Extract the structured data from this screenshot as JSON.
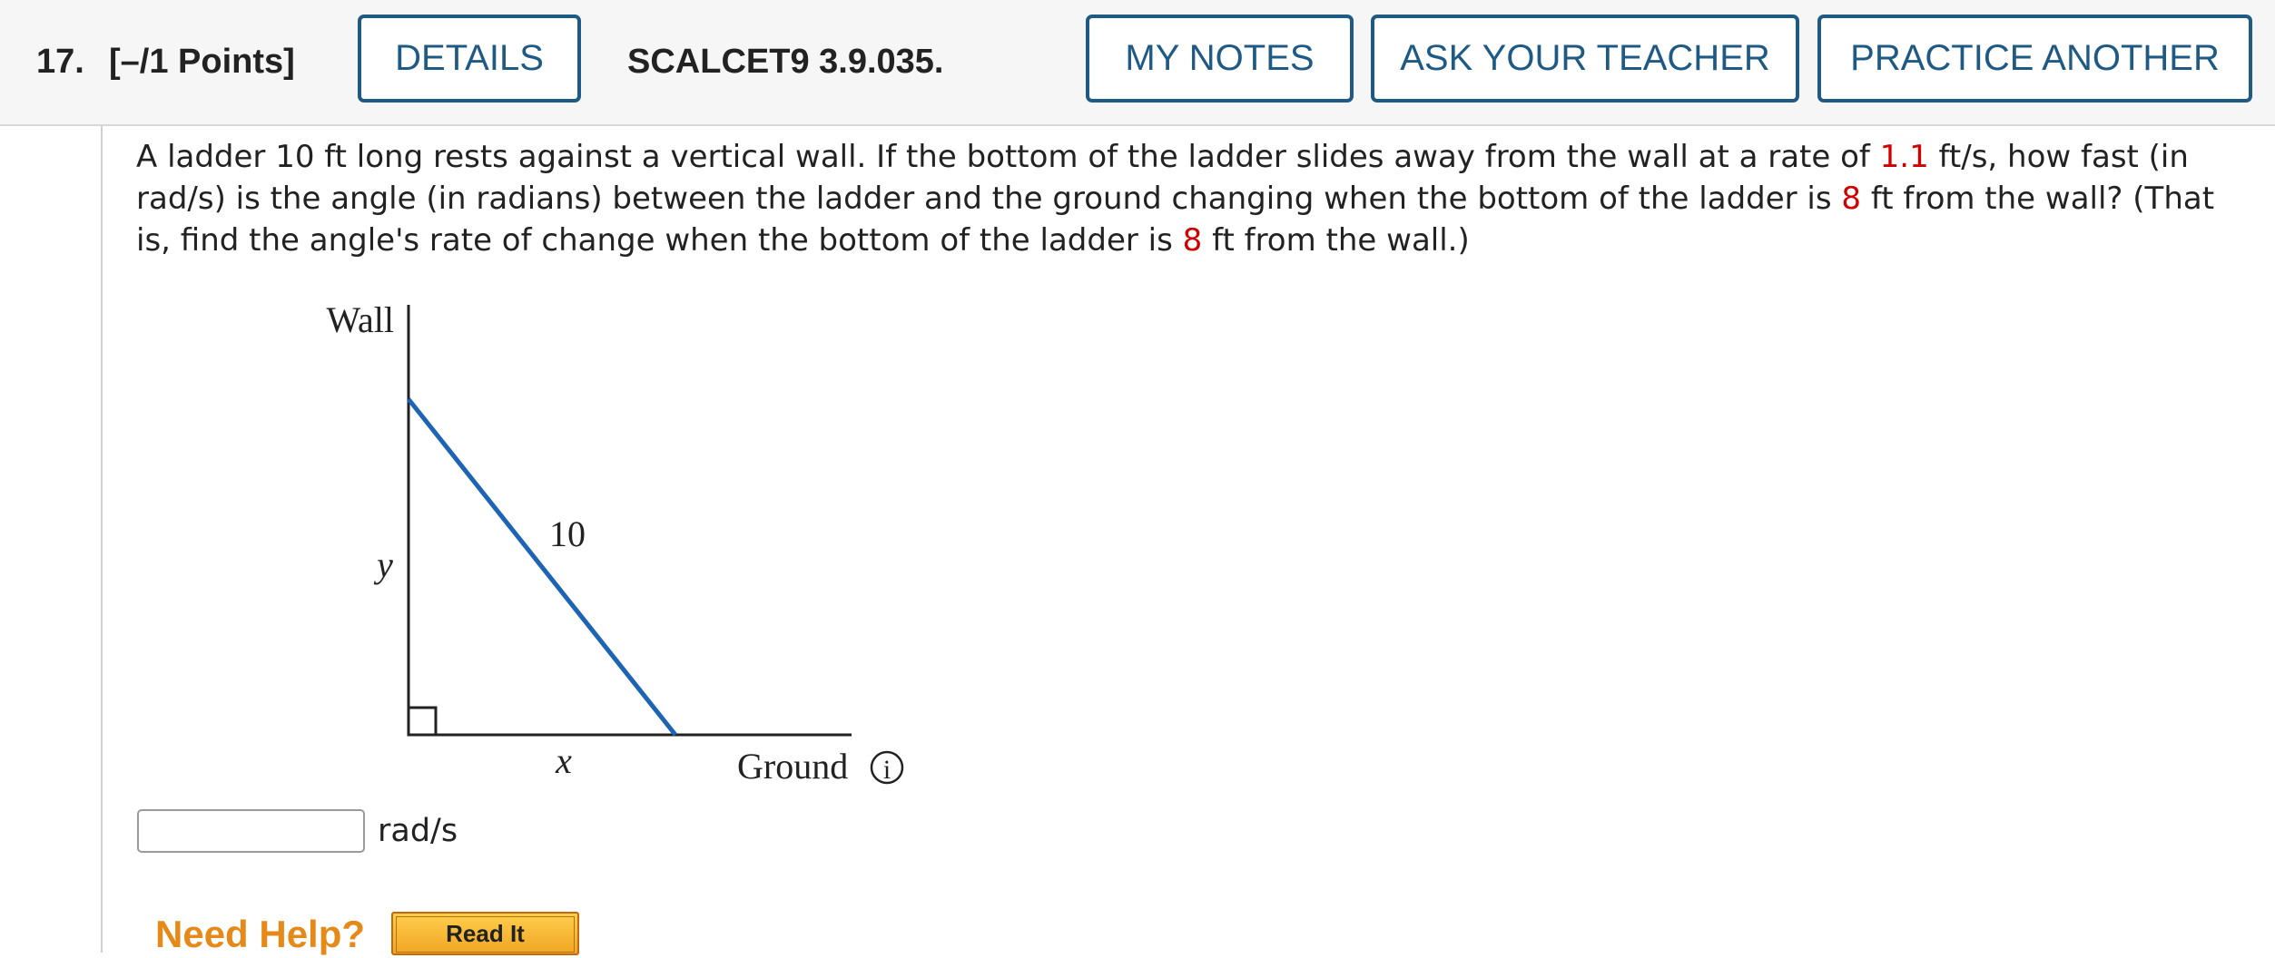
{
  "header": {
    "question_number": "17.",
    "points": "[–/1 Points]",
    "details_label": "DETAILS",
    "problem_id": "SCALCET9 3.9.035.",
    "my_notes_label": "MY NOTES",
    "ask_teacher_label": "ASK YOUR TEACHER",
    "practice_another_label": "PRACTICE ANOTHER"
  },
  "question": {
    "part1": "A ladder 10 ft long rests against a vertical wall. If the bottom of the ladder slides away from the wall at a rate of ",
    "rate": "1.1",
    "part2": " ft/s, how fast (in rad/s) is the angle (in radians) between the ladder and the ground changing when the bottom of the ladder is ",
    "distance1": "8",
    "part3": " ft from the wall? (That is, find the angle's rate of change when the bottom of the ladder is ",
    "distance2": "8",
    "part4": " ft from the wall.)"
  },
  "figure": {
    "wall_label": "Wall",
    "ladder_label": "10",
    "height_label": "y",
    "base_label": "x",
    "ground_label": "Ground",
    "info_icon_glyph": "i",
    "ladder_color": "#1e64b4"
  },
  "answer": {
    "value": "",
    "placeholder": "",
    "unit": "rad/s"
  },
  "help": {
    "need_help_label": "Need Help?",
    "read_it_label": "Read It"
  },
  "colors": {
    "button_border": "#1f5a84",
    "highlight_red": "#d10000",
    "need_help_orange": "#e58a18"
  }
}
